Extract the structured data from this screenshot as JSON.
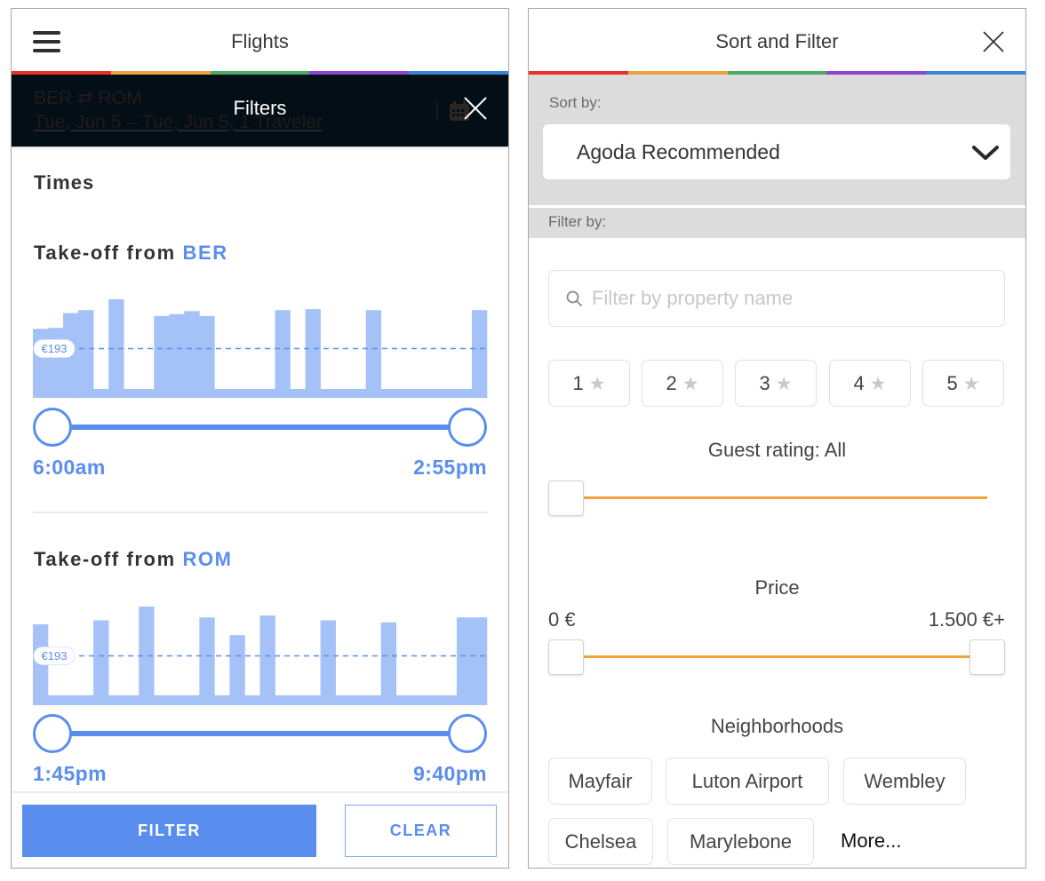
{
  "colors": {
    "brand_stripe": [
      "#e8322b",
      "#f0a23c",
      "#4caa62",
      "#8a45d1",
      "#3a84d9"
    ],
    "accent_blue": "#5a8eee",
    "histogram_bar": "#a4c2f7",
    "slider_orange": "#f0a23c",
    "overlay_dark": "#040e16"
  },
  "flights_panel": {
    "header": {
      "title": "Flights",
      "menu_icon": "hamburger-menu-icon"
    },
    "trip": {
      "origin": "BER",
      "swap_symbol": "⇄",
      "destination": "ROM",
      "dates_travelers": "Tue, Jun 5 – Tue, Jun 5, 1 Traveler"
    },
    "filters_sheet": {
      "title": "Filters",
      "section_title": "Times",
      "takeoff": [
        {
          "label": "Take-off from",
          "airport": "BER",
          "start_time": "6:00am",
          "end_time": "2:55pm",
          "slider": {
            "low": 0,
            "high": 1
          }
        },
        {
          "label": "Take-off from",
          "airport": "ROM",
          "start_time": "1:45pm",
          "end_time": "9:40pm",
          "slider": {
            "low": 0,
            "high": 1
          }
        }
      ],
      "footer": {
        "filter_button": "FILTER",
        "clear_button": "CLEAR"
      }
    }
  },
  "sort_filter_panel": {
    "title": "Sort and Filter",
    "sort_by_label": "Sort by:",
    "sort_selected": "Agoda Recommended",
    "filter_by_label": "Filter by:",
    "search_placeholder": "Filter by property name",
    "star_ratings": [
      "1",
      "2",
      "3",
      "4",
      "5"
    ],
    "guest_rating": {
      "label": "Guest rating: All",
      "slider": {
        "low": 0,
        "high": 1
      }
    },
    "price": {
      "label": "Price",
      "min_label": "0 €",
      "max_label": "1.500 €+",
      "slider": {
        "low": 0,
        "high": 1
      }
    },
    "neighborhoods": {
      "label": "Neighborhoods",
      "chips": [
        "Mayfair",
        "Luton Airport",
        "Wembley",
        "Chelsea",
        "Marylebone"
      ],
      "more_link": "More..."
    }
  },
  "chart_data": [
    {
      "type": "bar",
      "title": "Take-off from BER",
      "xlabel": "",
      "ylabel": "",
      "value_units": "relative price (% of tallest bar)",
      "ylim": [
        0,
        100
      ],
      "grid": false,
      "legend": "none",
      "values": [
        70,
        71,
        86,
        89,
        9,
        100,
        9,
        9,
        83,
        85,
        88,
        83,
        9,
        9,
        9,
        9,
        89,
        9,
        90,
        9,
        9,
        9,
        89,
        9,
        9,
        9,
        9,
        9,
        9,
        89
      ],
      "reference_line": {
        "label": "€193",
        "value": 50
      }
    },
    {
      "type": "bar",
      "title": "Take-off from ROM",
      "xlabel": "",
      "ylabel": "",
      "value_units": "relative price (% of tallest bar)",
      "ylim": [
        0,
        100
      ],
      "grid": false,
      "legend": "none",
      "values": [
        82,
        10,
        10,
        10,
        86,
        10,
        10,
        100,
        10,
        10,
        10,
        89,
        10,
        71,
        10,
        91,
        10,
        10,
        10,
        86,
        10,
        10,
        10,
        84,
        10,
        10,
        10,
        10,
        89,
        89
      ],
      "reference_line": {
        "label": "€193",
        "value": 50
      }
    }
  ]
}
